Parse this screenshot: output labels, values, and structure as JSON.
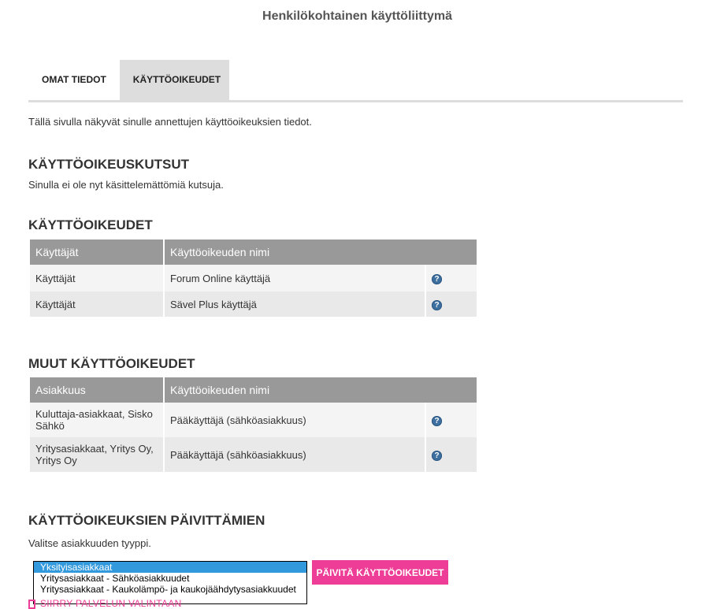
{
  "page": {
    "title": "Henkilökohtainen käyttöliittymä"
  },
  "tabs": [
    {
      "label": "OMAT TIEDOT",
      "active": false
    },
    {
      "label": "KÄYTTÖOIKEUDET",
      "active": true
    }
  ],
  "intro": "Tällä sivulla näkyvät sinulle annettujen käyttöoikeuksien tiedot.",
  "invitations": {
    "heading": "KÄYTTÖOIKEUSKUTSUT",
    "text": "Sinulla ei ole nyt käsittelemättömiä kutsuja."
  },
  "rights": {
    "heading": "KÄYTTÖOIKEUDET",
    "columns": [
      "Käyttäjät",
      "Käyttöoikeuden nimi"
    ],
    "rows": [
      {
        "group": "Käyttäjät",
        "name": "Forum Online käyttäjä",
        "icon": "question-icon"
      },
      {
        "group": "Käyttäjät",
        "name": "Sävel Plus käyttäjä",
        "icon": "question-icon"
      }
    ]
  },
  "other_rights": {
    "heading": "MUUT KÄYTTÖOIKEUDET",
    "columns": [
      "Asiakkuus",
      "Käyttöoikeuden nimi"
    ],
    "rows": [
      {
        "customer": "Kuluttaja-asiakkaat, Sisko Sähkö",
        "name": "Pääkäyttäjä (sähköasiakkuus)",
        "icon": "question-icon"
      },
      {
        "customer": "Yritysasiakkaat, Yritys Oy, Yritys Oy",
        "name": "Pääkäyttäjä (sähköasiakkuus)",
        "icon": "question-icon"
      }
    ]
  },
  "update": {
    "heading": "KÄYTTÖOIKEUKSIEN PÄIVITTÄMIEN",
    "text": "Valitse asiakkuuden tyyppi.",
    "options": [
      "Yksityisasiakkaat",
      "Yritysasiakkaat - Sähköasiakkuudet",
      "Yritysasiakkaat - Kaukolämpö- ja kaukojäähdytysasiakkuudet"
    ],
    "selected_index": 0,
    "button_label": "PÄIVITÄ KÄYTTÖOIKEUDET",
    "back_link": "SIIRRY PALVELUN VALINTAAN"
  },
  "colors": {
    "accent": "#ee3d96",
    "table_header": "#999999",
    "tab_active": "#dddddd",
    "selected_option": "#3399dd",
    "help_icon": "#3d6fa0"
  }
}
